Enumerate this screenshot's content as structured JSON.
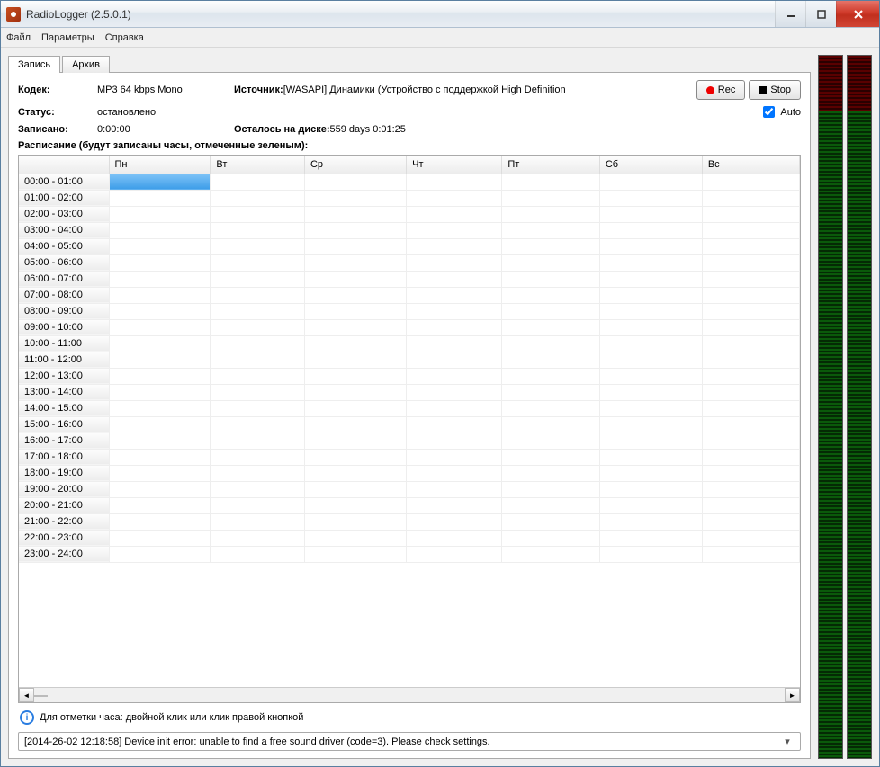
{
  "window": {
    "title": "RadioLogger (2.5.0.1)"
  },
  "menu": {
    "file": "Файл",
    "params": "Параметры",
    "help": "Справка"
  },
  "tabs": {
    "record": "Запись",
    "archive": "Архив"
  },
  "info": {
    "codec_label": "Кодек:",
    "codec_value": "MP3 64 kbps Mono",
    "source_label": "Источник:",
    "source_value": "[WASAPI] Динамики (Устройство с поддержкой High Definition",
    "status_label": "Статус:",
    "status_value": "остановлено",
    "recorded_label": "Записано:",
    "recorded_value": "0:00:00",
    "diskleft_label": "Осталось на диске:",
    "diskleft_value": "559 days 0:01:25"
  },
  "buttons": {
    "rec": "Rec",
    "stop": "Stop",
    "auto": "Auto"
  },
  "schedule": {
    "header": "Расписание (будут записаны часы, отмеченные зеленым):",
    "days": [
      "Пн",
      "Вт",
      "Ср",
      "Чт",
      "Пт",
      "Сб",
      "Вс"
    ],
    "hours": [
      "00:00 - 01:00",
      "01:00 - 02:00",
      "02:00 - 03:00",
      "03:00 - 04:00",
      "04:00 - 05:00",
      "05:00 - 06:00",
      "06:00 - 07:00",
      "07:00 - 08:00",
      "08:00 - 09:00",
      "09:00 - 10:00",
      "10:00 - 11:00",
      "11:00 - 12:00",
      "12:00 - 13:00",
      "13:00 - 14:00",
      "14:00 - 15:00",
      "15:00 - 16:00",
      "16:00 - 17:00",
      "17:00 - 18:00",
      "18:00 - 19:00",
      "19:00 - 20:00",
      "20:00 - 21:00",
      "21:00 - 22:00",
      "22:00 - 23:00",
      "23:00 - 24:00"
    ],
    "selected_row": 0,
    "selected_col": 0
  },
  "hint": "Для отметки часа: двойной клик или клик правой кнопкой",
  "log": "[2014-26-02 12:18:58]  Device init error: unable to find a free sound driver (code=3). Please check settings."
}
